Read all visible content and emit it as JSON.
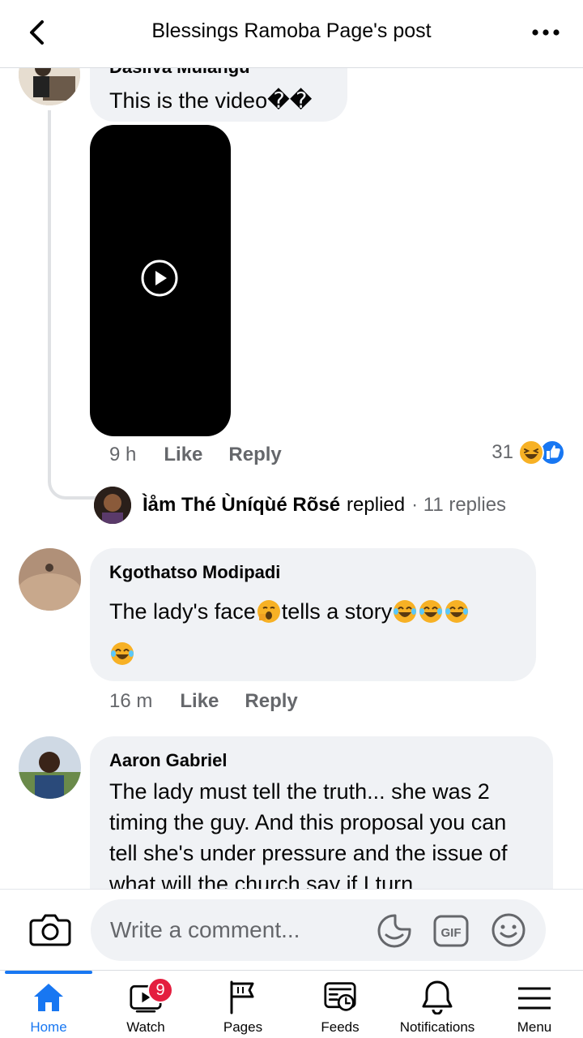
{
  "header": {
    "title": "Blessings Ramoba Page's post"
  },
  "comments": [
    {
      "author": "Dasilva Mulangu",
      "text": "This is the video��",
      "time": "9 h",
      "like_label": "Like",
      "reply_label": "Reply",
      "reaction_count": "31",
      "replies_summary": {
        "replier": "Ìåm Thé Ùníqùé Rõsé",
        "replied_label": "replied",
        "count_text": "· 11 replies"
      }
    },
    {
      "author": "Kgothatso Modipadi",
      "text_part1": "The lady's face",
      "text_part2": "tells a story",
      "time": "16 m",
      "like_label": "Like",
      "reply_label": "Reply"
    },
    {
      "author": "Aaron Gabriel",
      "text": "The lady must tell the truth... she was 2 timing the guy. And this proposal you can tell she's under pressure and the issue of what will the church say if I turn"
    }
  ],
  "composer": {
    "placeholder": "Write a comment...",
    "gif_label": "GIF"
  },
  "tabs": [
    {
      "label": "Home",
      "active": true
    },
    {
      "label": "Watch",
      "badge": "9"
    },
    {
      "label": "Pages"
    },
    {
      "label": "Feeds"
    },
    {
      "label": "Notifications"
    },
    {
      "label": "Menu"
    }
  ],
  "colors": {
    "accent": "#1877f2",
    "badge": "#e41e3f",
    "bubble": "#f0f2f5",
    "secondary_text": "#65676b"
  },
  "icons": [
    "back-arrow-icon",
    "more-icon",
    "play-icon",
    "haha-reaction-icon",
    "like-reaction-icon",
    "camera-icon",
    "sticker-icon",
    "gif-icon",
    "smile-icon",
    "home-icon",
    "watch-icon",
    "pages-icon",
    "feeds-icon",
    "bell-icon",
    "menu-icon"
  ]
}
